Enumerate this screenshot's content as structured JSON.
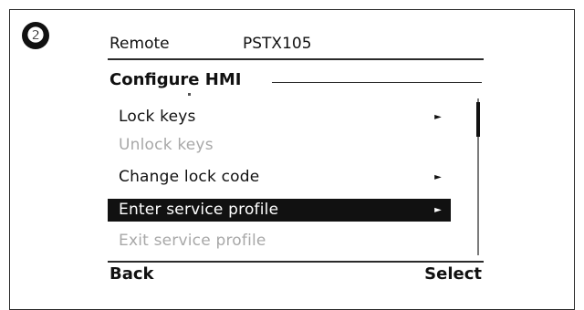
{
  "step_badge": "❷",
  "header": {
    "remote_label": "Remote",
    "device_name": "PSTX105"
  },
  "screen": {
    "title": "Configure HMI",
    "menu_items": [
      {
        "label": "Lock keys",
        "state": "enabled",
        "has_submenu": true
      },
      {
        "label": "Unlock keys",
        "state": "disabled",
        "has_submenu": false
      },
      {
        "label": "Change lock code",
        "state": "enabled",
        "has_submenu": true
      },
      {
        "label": "Enter service profile",
        "state": "selected",
        "has_submenu": true
      },
      {
        "label": "Exit service profile",
        "state": "disabled",
        "has_submenu": false
      }
    ],
    "submenu_arrow": "►"
  },
  "softkeys": {
    "left_label": "Back",
    "right_label": "Select"
  },
  "colors": {
    "background": "#ffffff",
    "text": "#111111",
    "disabled_text": "#a8a8a8",
    "highlight_background": "#111111",
    "highlight_text": "#ffffff"
  }
}
